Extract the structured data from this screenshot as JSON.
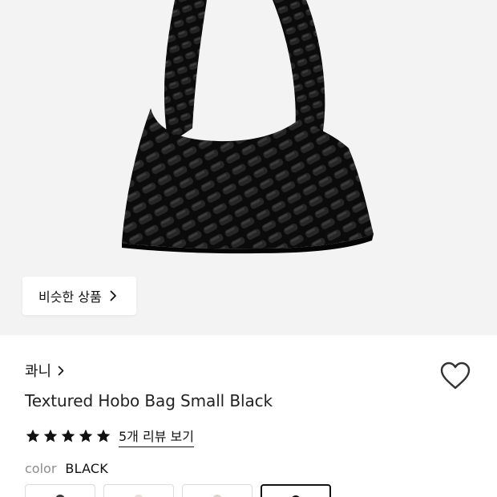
{
  "product_image": {
    "alt": "",
    "similar_button_label": "비슷한 상품"
  },
  "brand": {
    "name": "콰니"
  },
  "product": {
    "title": "Textured Hobo Bag Small Black",
    "rating": 5,
    "rating_max": 5,
    "review_link_label": "5개 리뷰 보기"
  },
  "color_option": {
    "label": "color",
    "value": "BLACK",
    "swatches": [
      {
        "color": "#3a3a3a",
        "selected": false
      },
      {
        "color": "#e6e1d8",
        "selected": false
      },
      {
        "color": "#d9d4cc",
        "selected": false
      },
      {
        "color": "#111111",
        "selected": true
      }
    ]
  },
  "icons": {
    "wishlist": "heart-outline-icon",
    "chevron": "chevron-right-icon",
    "star": "star-filled-icon"
  },
  "colors": {
    "image_background": "#f3f3f3",
    "text_primary": "#111111",
    "text_muted": "#8c8c8c"
  }
}
